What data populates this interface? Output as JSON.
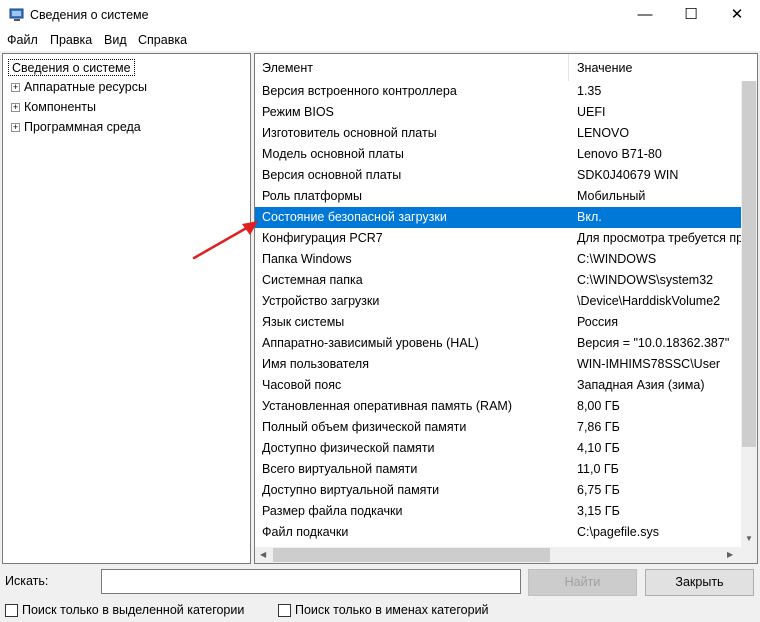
{
  "window": {
    "title": "Сведения о системе",
    "controls": {
      "minimize": "—",
      "maximize": "☐",
      "close": "✕"
    }
  },
  "menu": [
    "Файл",
    "Правка",
    "Вид",
    "Справка"
  ],
  "tree": {
    "root": "Сведения о системе",
    "children": [
      "Аппаратные ресурсы",
      "Компоненты",
      "Программная среда"
    ],
    "expander": "+"
  },
  "table": {
    "headers": [
      "Элемент",
      "Значение"
    ],
    "rows": [
      [
        "Версия встроенного контроллера",
        "1.35"
      ],
      [
        "Режим BIOS",
        "UEFI"
      ],
      [
        "Изготовитель основной платы",
        "LENOVO"
      ],
      [
        "Модель основной платы",
        "Lenovo B71-80"
      ],
      [
        "Версия основной платы",
        "SDK0J40679 WIN"
      ],
      [
        "Роль платформы",
        "Мобильный"
      ],
      [
        "Состояние безопасной загрузки",
        "Вкл."
      ],
      [
        "Конфигурация PCR7",
        "Для просмотра требуется пра"
      ],
      [
        "Папка Windows",
        "C:\\WINDOWS"
      ],
      [
        "Системная папка",
        "C:\\WINDOWS\\system32"
      ],
      [
        "Устройство загрузки",
        "\\Device\\HarddiskVolume2"
      ],
      [
        "Язык системы",
        "Россия"
      ],
      [
        "Аппаратно-зависимый уровень (HAL)",
        "Версия = \"10.0.18362.387\""
      ],
      [
        "Имя пользователя",
        "WIN-IMHIMS78SSC\\User"
      ],
      [
        "Часовой пояс",
        "Западная Азия (зима)"
      ],
      [
        "Установленная оперативная память (RAM)",
        "8,00 ГБ"
      ],
      [
        "Полный объем физической памяти",
        "7,86 ГБ"
      ],
      [
        "Доступно физической памяти",
        "4,10 ГБ"
      ],
      [
        "Всего виртуальной памяти",
        "11,0 ГБ"
      ],
      [
        "Доступно виртуальной памяти",
        "6,75 ГБ"
      ],
      [
        "Размер файла подкачки",
        "3,15 ГБ"
      ],
      [
        "Файл подкачки",
        "C:\\pagefile.sys"
      ]
    ],
    "selected_row": 6,
    "colors": {
      "selection": "#0078d7",
      "annotation_arrow": "#e02020"
    }
  },
  "search": {
    "label": "Искать:",
    "value": ""
  },
  "buttons": {
    "find": "Найти",
    "close": "Закрыть"
  },
  "checkboxes": [
    {
      "label": "Поиск только в выделенной категории",
      "checked": false
    },
    {
      "label": "Поиск только в именах категорий",
      "checked": false
    }
  ]
}
